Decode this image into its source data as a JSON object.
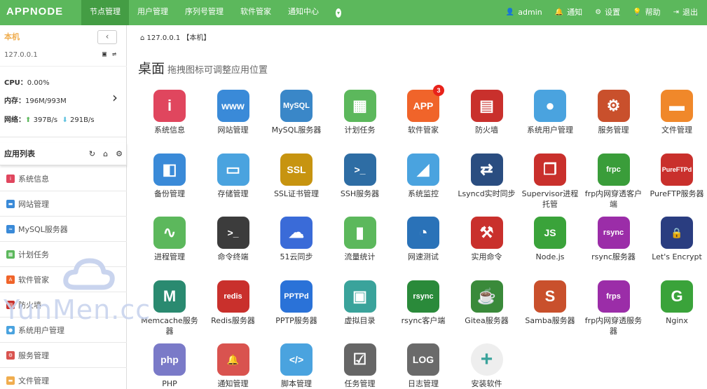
{
  "header": {
    "logo": "APPNODE",
    "nav": [
      "节点管理",
      "用户管理",
      "序列号管理",
      "软件管家",
      "通知中心"
    ],
    "user": "admin",
    "notify": "通知",
    "settings": "设置",
    "help": "帮助",
    "logout": "退出"
  },
  "sidebar": {
    "host_title": "本机",
    "collapse": "‹",
    "ip": "127.0.0.1",
    "cpu_label": "CPU：",
    "cpu_value": "0.00%",
    "mem_label": "内存：",
    "mem_value": "196M/993M",
    "net_label": "网络：",
    "net_up": "397B/s",
    "net_down": "291B/s",
    "applist_title": "应用列表",
    "items": [
      {
        "label": "系统信息",
        "color": "#e0465e"
      },
      {
        "label": "网站管理",
        "color": "#3a8ad8"
      },
      {
        "label": "MySQL服务器",
        "color": "#3a8ad8"
      },
      {
        "label": "计划任务",
        "color": "#5cb85c"
      },
      {
        "label": "软件管家",
        "color": "#f0642a"
      },
      {
        "label": "防火墙",
        "color": "#c9302c"
      },
      {
        "label": "系统用户管理",
        "color": "#4aa3df"
      },
      {
        "label": "服务管理",
        "color": "#d9534f"
      },
      {
        "label": "文件管理",
        "color": "#f0ad4e"
      }
    ]
  },
  "main": {
    "breadcrumb": "127.0.0.1 【本机】",
    "title": "桌面",
    "subtitle": "拖拽图标可调整应用位置",
    "apps": [
      {
        "label": "系统信息",
        "color": "#e0465e",
        "glyph": "i"
      },
      {
        "label": "网站管理",
        "color": "#3a8ad8",
        "glyph": "www"
      },
      {
        "label": "MySQL服务器",
        "color": "#3a87c8",
        "glyph": "MySQL"
      },
      {
        "label": "计划任务",
        "color": "#5cb85c",
        "glyph": "▦"
      },
      {
        "label": "软件管家",
        "color": "#f0642a",
        "glyph": "APP",
        "badge": "3"
      },
      {
        "label": "防火墙",
        "color": "#c9302c",
        "glyph": "▤"
      },
      {
        "label": "系统用户管理",
        "color": "#4aa3df",
        "glyph": "●"
      },
      {
        "label": "服务管理",
        "color": "#c9502c",
        "glyph": "⚙"
      },
      {
        "label": "文件管理",
        "color": "#f0882a",
        "glyph": "▬"
      },
      {
        "label": "备份管理",
        "color": "#3a8ad8",
        "glyph": "◧"
      },
      {
        "label": "存储管理",
        "color": "#4aa3df",
        "glyph": "▭"
      },
      {
        "label": "SSL证书管理",
        "color": "#c79410",
        "glyph": "SSL"
      },
      {
        "label": "SSH服务器",
        "color": "#2e6da4",
        "glyph": ">_"
      },
      {
        "label": "系统监控",
        "color": "#4aa3df",
        "glyph": "◢"
      },
      {
        "label": "Lsyncd实时同步",
        "color": "#2a4d80",
        "glyph": "⇄"
      },
      {
        "label": "Supervisor进程托管",
        "color": "#c9302c",
        "glyph": "❐"
      },
      {
        "label": "frp内网穿透客户端",
        "color": "#3a9d3a",
        "glyph": "frpc"
      },
      {
        "label": "PureFTP服务器",
        "color": "#c9302c",
        "glyph": "PureFTPd"
      },
      {
        "label": "进程管理",
        "color": "#5cb85c",
        "glyph": "∿"
      },
      {
        "label": "命令终端",
        "color": "#3c3c3c",
        "glyph": ">_"
      },
      {
        "label": "51云同步",
        "color": "#3a6bd8",
        "glyph": "☁"
      },
      {
        "label": "流量统计",
        "color": "#5cb85c",
        "glyph": "▮"
      },
      {
        "label": "网速测试",
        "color": "#2a72b8",
        "glyph": "◔"
      },
      {
        "label": "实用命令",
        "color": "#c9302c",
        "glyph": "⚒"
      },
      {
        "label": "Node.js",
        "color": "#3aa33a",
        "glyph": "JS"
      },
      {
        "label": "rsync服务器",
        "color": "#9b2da8",
        "glyph": "rsync"
      },
      {
        "label": "Let's Encrypt",
        "color": "#2a3d80",
        "glyph": "🔒"
      },
      {
        "label": "Memcache服务器",
        "color": "#2a8a70",
        "glyph": "M"
      },
      {
        "label": "Redis服务器",
        "color": "#c9302c",
        "glyph": "redis"
      },
      {
        "label": "PPTP服务器",
        "color": "#2a72d8",
        "glyph": "PPTPd"
      },
      {
        "label": "虚拟目录",
        "color": "#3aa39b",
        "glyph": "▣"
      },
      {
        "label": "rsync客户端",
        "color": "#2a8a3a",
        "glyph": "rsync"
      },
      {
        "label": "Gitea服务器",
        "color": "#3a8a3a",
        "glyph": "☕"
      },
      {
        "label": "Samba服务器",
        "color": "#c9502c",
        "glyph": "S"
      },
      {
        "label": "frp内网穿透服务器",
        "color": "#9b2da8",
        "glyph": "frps"
      },
      {
        "label": "Nginx",
        "color": "#3aa33a",
        "glyph": "G"
      },
      {
        "label": "PHP",
        "color": "#7a7ac8",
        "glyph": "php"
      },
      {
        "label": "通知管理",
        "color": "#d9534f",
        "glyph": "🔔"
      },
      {
        "label": "脚本管理",
        "color": "#4aa3df",
        "glyph": "</>"
      },
      {
        "label": "任务管理",
        "color": "#666666",
        "glyph": "☑"
      },
      {
        "label": "日志管理",
        "color": "#6a6a6a",
        "glyph": "LOG"
      },
      {
        "label": "安装软件",
        "color": "#eeeeee",
        "glyph": "+"
      }
    ]
  },
  "watermark": "YunMen.cc"
}
